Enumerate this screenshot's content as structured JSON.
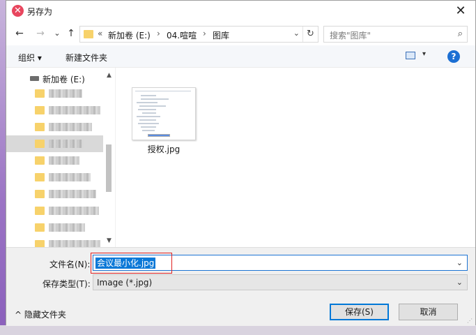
{
  "window": {
    "title": "另存为",
    "close_glyph": "✕"
  },
  "nav": {
    "back_glyph": "←",
    "forward_glyph": "→",
    "recent_glyph": "⌄",
    "up_glyph": "↑",
    "breadcrumb": {
      "overflow": "«",
      "drive": "新加卷 (E:)",
      "folder1": "04.喧喧",
      "folder2": "图库",
      "sep": "›"
    },
    "dropdown_glyph": "⌄",
    "refresh_glyph": "↻",
    "search_placeholder": "搜索\"图库\"",
    "search_glyph": "⌕"
  },
  "toolbar": {
    "organize": "组织 ▾",
    "new_folder": "新建文件夹",
    "view_dd": "▾",
    "help": "?"
  },
  "navpane": {
    "drive_label": "新加卷 (E:)",
    "scroll_up": "▲",
    "scroll_down": "▼"
  },
  "files": [
    {
      "name": "授权.jpg"
    }
  ],
  "save": {
    "filename_label": "文件名(N):",
    "filename_value": "会议最小化.jpg",
    "filetype_label": "保存类型(T):",
    "filetype_value": "Image (*.jpg)",
    "combo_arrow": "⌄",
    "hide_folders": "^ 隐藏文件夹",
    "save_button": "保存(S)",
    "cancel_button": "取消"
  },
  "colors": {
    "accent": "#0078d7",
    "highlight_box": "#e02020",
    "folder": "#f7d26b"
  }
}
